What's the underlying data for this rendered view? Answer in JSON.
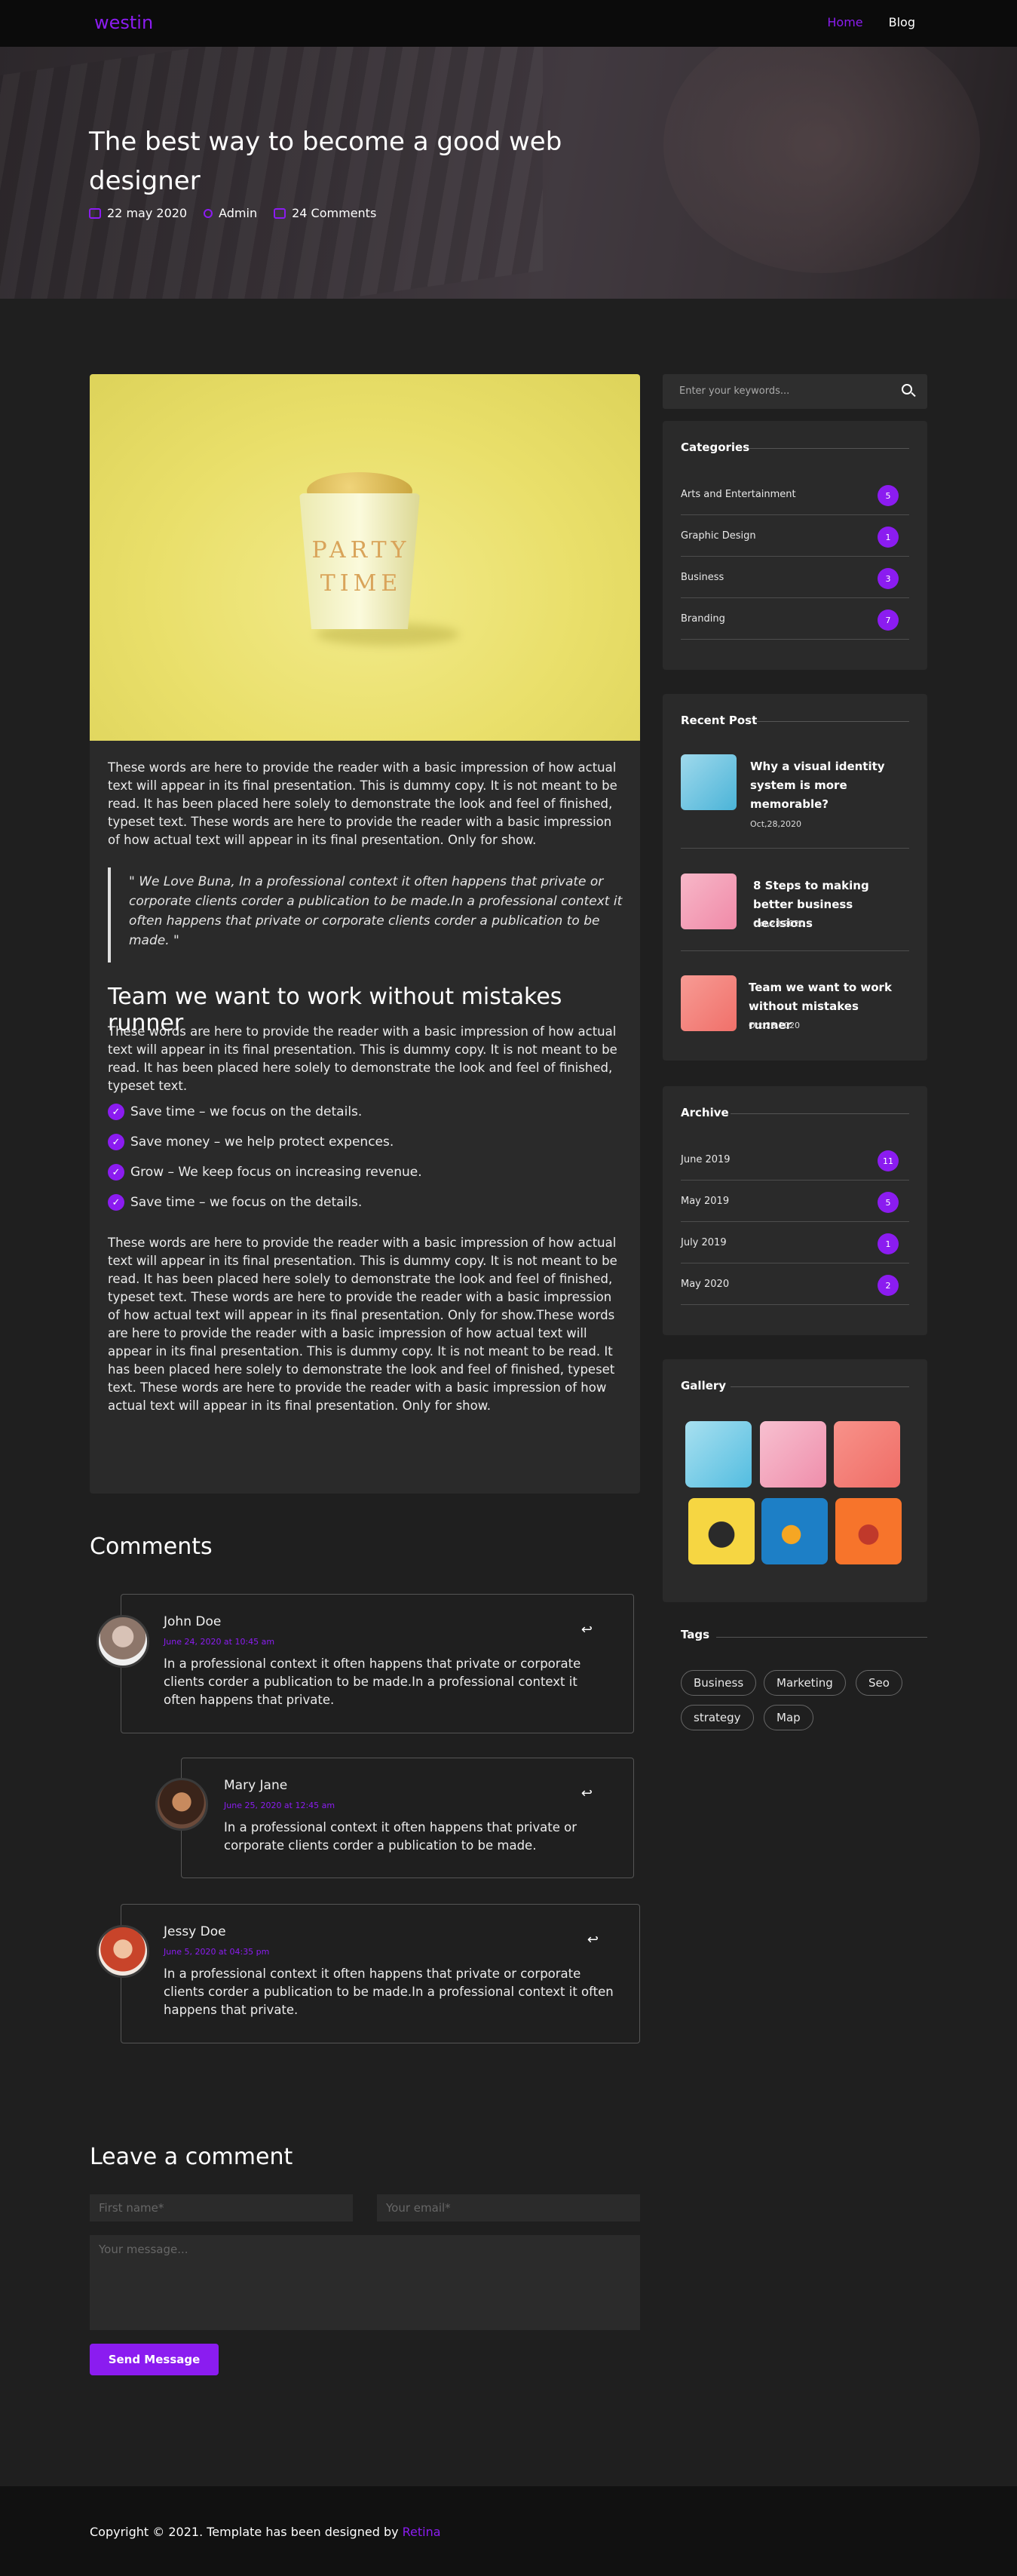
{
  "header": {
    "logo": "westin",
    "nav": [
      {
        "label": "Home",
        "active": true
      },
      {
        "label": "Blog",
        "active": false
      }
    ]
  },
  "hero": {
    "title": "The best way to become a good web designer",
    "date": "22 may 2020",
    "author": "Admin",
    "comments": "24 Comments"
  },
  "article": {
    "image_text": "PARTY TIME",
    "para1": "These words are here to provide the reader with a basic impression of how actual text will appear in its final presentation. This is dummy copy. It is not meant to be read. It has been placed here solely to demonstrate the look and feel of finished, typeset text. These words are here to provide the reader with a basic impression of how actual text will appear in its final presentation. Only for show.",
    "quote": "\" We Love Buna, In a professional context it often happens that private or corporate clients corder a publication to be made.In a professional context it often happens that private or corporate clients corder a publication to be made. \"",
    "heading": "Team we want to work without mistakes runner",
    "para2": "These words are here to provide the reader with a basic impression of how actual text will appear in its final presentation. This is dummy copy. It is not meant to be read. It has been placed here solely to demonstrate the look and feel of finished, typeset text.",
    "checklist": [
      "Save time – we focus on the details.",
      "Save money – we help protect expences.",
      "Grow – We keep focus on increasing revenue.",
      "Save time – we focus on the details."
    ],
    "para3": "These words are here to provide the reader with a basic impression of how actual text will appear in its final presentation. This is dummy copy. It is not meant to be read. It has been placed here solely to demonstrate the look and feel of finished, typeset text. These words are here to provide the reader with a basic impression of how actual text will appear in its final presentation. Only for show.These words are here to provide the reader with a basic impression of how actual text will appear in its final presentation. This is dummy copy. It is not meant to be read. It has been placed here solely to demonstrate the look and feel of finished, typeset text. These words are here to provide the reader with a basic impression of how actual text will appear in its final presentation. Only for show."
  },
  "comments": {
    "title": "Comments",
    "items": [
      {
        "name": "John Doe",
        "date": "June 24, 2020 at 10:45 am",
        "text": "In a professional context it often happens that private or corporate clients corder a publication to be made.In a professional context it often happens that private."
      },
      {
        "name": "Mary Jane",
        "date": "June 25, 2020 at 12:45 am",
        "text": "In a professional context it often happens that private or corporate clients corder a publication to be made."
      },
      {
        "name": "Jessy Doe",
        "date": "June 5, 2020 at 04:35 pm",
        "text": "In a professional context it often happens that private or corporate clients corder a publication to be made.In a professional context it often happens that private."
      }
    ]
  },
  "form": {
    "title": "Leave a comment",
    "first_name_placeholder": "First name*",
    "email_placeholder": "Your email*",
    "message_placeholder": "Your message...",
    "send_label": "Send Message"
  },
  "sidebar": {
    "search_placeholder": "Enter your keywords...",
    "categories_title": "Categories",
    "categories": [
      {
        "name": "Arts and Entertainment",
        "count": "5"
      },
      {
        "name": "Graphic Design",
        "count": "1"
      },
      {
        "name": "Business",
        "count": "3"
      },
      {
        "name": "Branding",
        "count": "7"
      }
    ],
    "recent_title": "Recent Post",
    "recent": [
      {
        "title": "Why a visual identity system is more memorable?",
        "date": "Oct,28,2020"
      },
      {
        "title": "8 Steps to making better business decisions",
        "date": "Oct,28,2020"
      },
      {
        "title": "Team we want to work without mistakes runner",
        "date": "Oct,28,2020"
      }
    ],
    "archive_title": "Archive",
    "archive": [
      {
        "name": "June 2019",
        "count": "11"
      },
      {
        "name": "May 2019",
        "count": "5"
      },
      {
        "name": "July 2019",
        "count": "1"
      },
      {
        "name": "May 2020",
        "count": "2"
      }
    ],
    "gallery_title": "Gallery",
    "tags_title": "Tags",
    "tags": [
      "Business",
      "Marketing",
      "Seo",
      "strategy",
      "Map"
    ]
  },
  "footer": {
    "copyright": "Copyright © 2021. Template has been designed by ",
    "brand": "Retina"
  }
}
